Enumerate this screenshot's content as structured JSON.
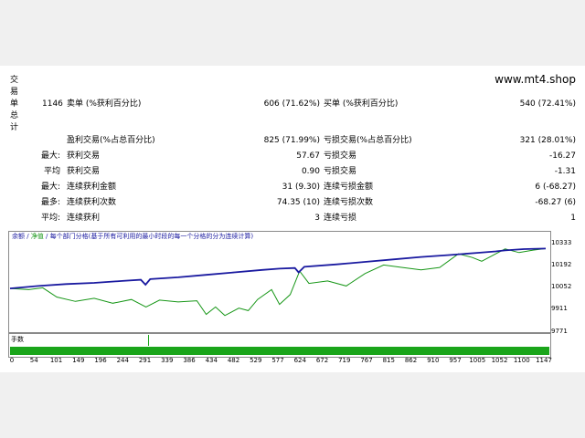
{
  "brand": "www.mt4.shop",
  "side_label": "交易单总计",
  "rows": [
    {
      "l1": "",
      "c1": "1146",
      "l2": "卖单 (%获利百分比)",
      "v1": "606 (71.62%)",
      "l3": "买单 (%获利百分比)",
      "v2": "540 (72.41%)"
    },
    {
      "l1": "",
      "c1": "",
      "l2": "盈利交易(%占总百分比)",
      "v1": "825 (71.99%)",
      "l3": "亏损交易(%占总百分比)",
      "v2": "321 (28.01%)"
    },
    {
      "l1": "最大:",
      "c1": "",
      "l2": "获利交易",
      "v1": "57.67",
      "l3": "亏损交易",
      "v2": "-16.27"
    },
    {
      "l1": "平均",
      "c1": "",
      "l2": "获利交易",
      "v1": "0.90",
      "l3": "亏损交易",
      "v2": "-1.31"
    },
    {
      "l1": "最大:",
      "c1": "",
      "l2": "连续获利金额",
      "v1": "31 (9.30)",
      "l3": "连续亏损金额",
      "v2": "6 (-68.27)"
    },
    {
      "l1": "最多:",
      "c1": "",
      "l2": "连续获利次数",
      "v1": "74.35 (10)",
      "l3": "连续亏损次数",
      "v2": "-68.27 (6)"
    },
    {
      "l1": "平均:",
      "c1": "",
      "l2": "连续获利",
      "v1": "3",
      "l3": "连续亏损",
      "v2": "1"
    }
  ],
  "chart": {
    "legend_balance": "余额",
    "legend_sep": " / ",
    "legend_equity": "净值",
    "legend_rest": " / 每个部门分格(基于所有可利用的最小时段的每一个分格的分为连续计算)",
    "y_ticks": [
      "10333",
      "10192",
      "10052",
      "9911",
      "9771"
    ],
    "volume_label": "手数",
    "x_ticks": [
      "0",
      "54",
      "101",
      "149",
      "196",
      "244",
      "291",
      "339",
      "386",
      "434",
      "482",
      "529",
      "577",
      "624",
      "672",
      "719",
      "767",
      "815",
      "862",
      "910",
      "957",
      "1005",
      "1052",
      "1100",
      "1147"
    ],
    "colors": {
      "balance": "#1a1aa0",
      "equity": "#169616",
      "volume": "#1aa51a"
    }
  },
  "chart_data": {
    "type": "line",
    "x_range": [
      0,
      1147
    ],
    "y_range": [
      9700,
      10380
    ],
    "series": [
      {
        "name": "余额",
        "points": [
          [
            0,
            10010
          ],
          [
            60,
            10030
          ],
          [
            120,
            10045
          ],
          [
            180,
            10055
          ],
          [
            240,
            10070
          ],
          [
            280,
            10080
          ],
          [
            290,
            10040
          ],
          [
            300,
            10085
          ],
          [
            360,
            10100
          ],
          [
            420,
            10120
          ],
          [
            480,
            10140
          ],
          [
            540,
            10160
          ],
          [
            577,
            10170
          ],
          [
            610,
            10175
          ],
          [
            618,
            10140
          ],
          [
            630,
            10185
          ],
          [
            700,
            10205
          ],
          [
            760,
            10225
          ],
          [
            820,
            10245
          ],
          [
            880,
            10265
          ],
          [
            940,
            10280
          ],
          [
            1000,
            10298
          ],
          [
            1040,
            10310
          ],
          [
            1060,
            10318
          ],
          [
            1100,
            10328
          ],
          [
            1147,
            10333
          ]
        ]
      },
      {
        "name": "净值",
        "points": [
          [
            0,
            10010
          ],
          [
            40,
            10000
          ],
          [
            70,
            10015
          ],
          [
            100,
            9940
          ],
          [
            140,
            9905
          ],
          [
            180,
            9930
          ],
          [
            220,
            9890
          ],
          [
            260,
            9920
          ],
          [
            291,
            9860
          ],
          [
            320,
            9915
          ],
          [
            360,
            9900
          ],
          [
            400,
            9910
          ],
          [
            420,
            9800
          ],
          [
            440,
            9860
          ],
          [
            460,
            9790
          ],
          [
            490,
            9850
          ],
          [
            510,
            9830
          ],
          [
            530,
            9920
          ],
          [
            560,
            10000
          ],
          [
            577,
            9880
          ],
          [
            600,
            9960
          ],
          [
            620,
            10150
          ],
          [
            640,
            10050
          ],
          [
            680,
            10070
          ],
          [
            720,
            10030
          ],
          [
            760,
            10130
          ],
          [
            800,
            10200
          ],
          [
            840,
            10180
          ],
          [
            880,
            10160
          ],
          [
            920,
            10180
          ],
          [
            960,
            10290
          ],
          [
            990,
            10260
          ],
          [
            1010,
            10230
          ],
          [
            1040,
            10290
          ],
          [
            1060,
            10330
          ],
          [
            1090,
            10300
          ],
          [
            1120,
            10320
          ],
          [
            1147,
            10333
          ]
        ]
      }
    ]
  }
}
